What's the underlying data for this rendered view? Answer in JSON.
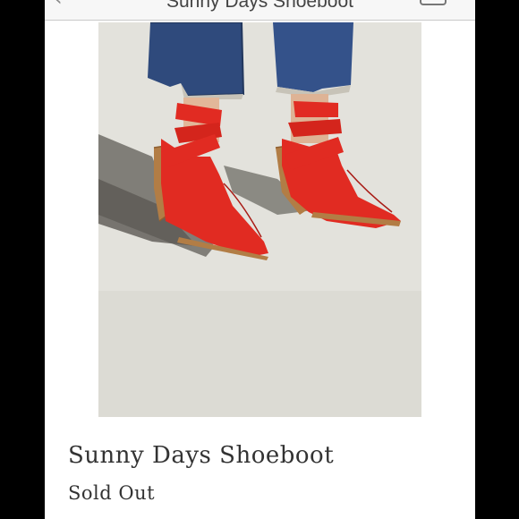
{
  "nav": {
    "title": "Sunny Days Shoeboot",
    "back_icon": "chevron-left-icon",
    "bag_icon": "shopping-bag-icon"
  },
  "product": {
    "name": "Sunny Days Shoeboot",
    "status": "Sold Out",
    "image_subject": "red-strappy-western-mules",
    "colors": {
      "boot": "#e12b22",
      "denim": "#2f4a7c",
      "heel": "#b27d45",
      "ground": "#e3e2dc"
    }
  }
}
